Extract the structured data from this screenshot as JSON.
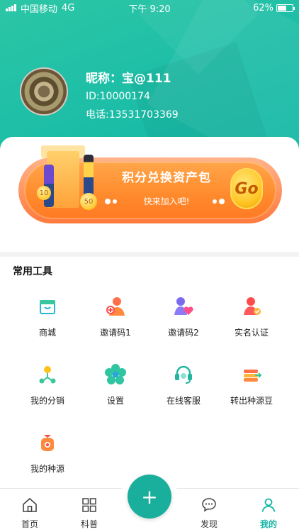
{
  "status_bar": {
    "carrier": "中国移动",
    "network": "4G",
    "time": "下午 9:20",
    "battery": "62%"
  },
  "profile": {
    "nickname": "昵称：宝@111",
    "id": "ID:10000174",
    "phone": "电话:13531703369"
  },
  "banner": {
    "title": "积分兑换资产包",
    "subtitle": "快来加入吧!",
    "go": "Go",
    "coin_10": "10",
    "coin_50": "50"
  },
  "tools_section": {
    "title": "常用工具",
    "items": [
      {
        "label": "商城",
        "icon": "shop-icon"
      },
      {
        "label": "邀请码1",
        "icon": "invite-user-icon"
      },
      {
        "label": "邀请码2",
        "icon": "invite-heart-icon"
      },
      {
        "label": "实名认证",
        "icon": "verify-user-icon"
      },
      {
        "label": "我的分销",
        "icon": "distribution-icon"
      },
      {
        "label": "设置",
        "icon": "settings-flower-icon"
      },
      {
        "label": "在线客服",
        "icon": "headset-icon"
      },
      {
        "label": "转出种源豆",
        "icon": "transfer-icon"
      },
      {
        "label": "我的种源",
        "icon": "seed-bag-icon"
      }
    ]
  },
  "tab_bar": {
    "home": "首页",
    "science": "科普",
    "add": "+",
    "discover": "发现",
    "mine": "我的",
    "active_color": "#18b5a5"
  },
  "colors": {
    "primary": "#1fbfa7",
    "accent": "#ff8a2c"
  }
}
